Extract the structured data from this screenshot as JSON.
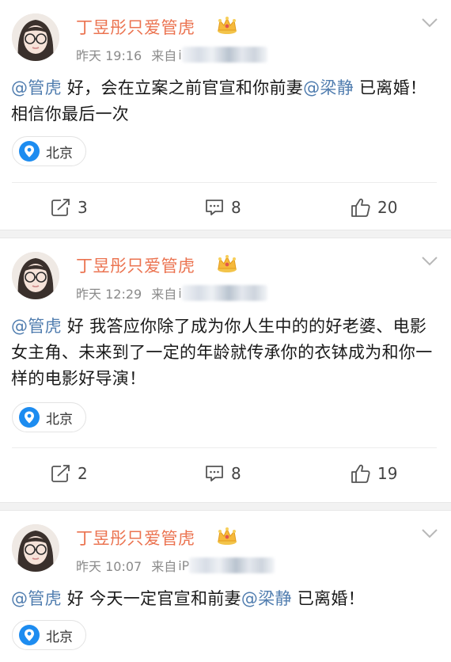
{
  "posts": [
    {
      "user_name": "丁昱彤只爱管虎",
      "time": "昨天 19:16",
      "source_prefix": "来自",
      "source_device": "i",
      "content_mention_1": "@管虎",
      "content_text_1": " 好，会在立案之前官宣和你前妻",
      "content_mention_2": "@梁静",
      "content_text_2": " 已离婚！相信你最后一次",
      "location": "北京",
      "reposts": "3",
      "comments": "8",
      "likes": "20"
    },
    {
      "user_name": "丁昱彤只爱管虎",
      "time": "昨天 12:29",
      "source_prefix": "来自",
      "source_device": "i",
      "content_mention_1": "@管虎",
      "content_text_1": " 好 我答应你除了成为你人生中的的好老婆、电影女主角、未来到了一定的年龄就传承你的衣钵成为和你一样的电影好导演！",
      "location": "北京",
      "reposts": "2",
      "comments": "8",
      "likes": "19"
    },
    {
      "user_name": "丁昱彤只爱管虎",
      "time": "昨天 10:07",
      "source_prefix": "来自",
      "source_device": "iP",
      "content_mention_1": "@管虎",
      "content_text_1": " 好 今天一定官宣和前妻",
      "content_mention_2": "@梁静",
      "content_text_2": " 已离婚！",
      "location": "北京"
    }
  ],
  "colors": {
    "username": "#eb7350",
    "mention": "#507daf",
    "meta": "#8a8a8a",
    "pin": "#1d8cf0",
    "separator": "#f2f2f2"
  },
  "icons": {
    "crown": "crown-icon",
    "chevron": "chevron-down-icon",
    "pin": "location-pin-icon",
    "repost": "repost-icon",
    "comment": "comment-icon",
    "like": "thumbs-up-icon"
  }
}
